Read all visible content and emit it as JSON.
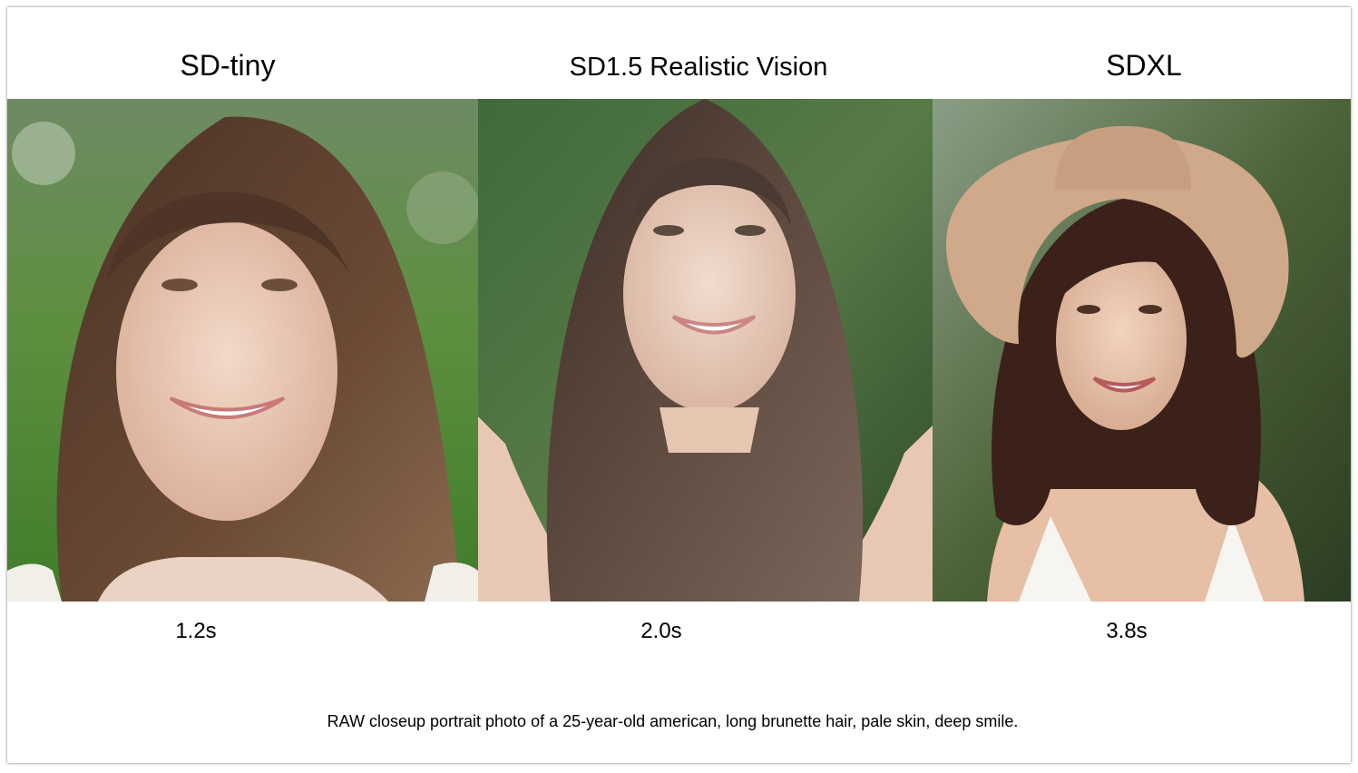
{
  "panels": [
    {
      "title": "SD-tiny",
      "time": "1.2s"
    },
    {
      "title": "SD1.5 Realistic Vision",
      "time": "2.0s"
    },
    {
      "title": "SDXL",
      "time": "3.8s"
    }
  ],
  "caption": "RAW closeup portrait photo of a 25-year-old american, long brunette hair, pale skin, deep smile."
}
